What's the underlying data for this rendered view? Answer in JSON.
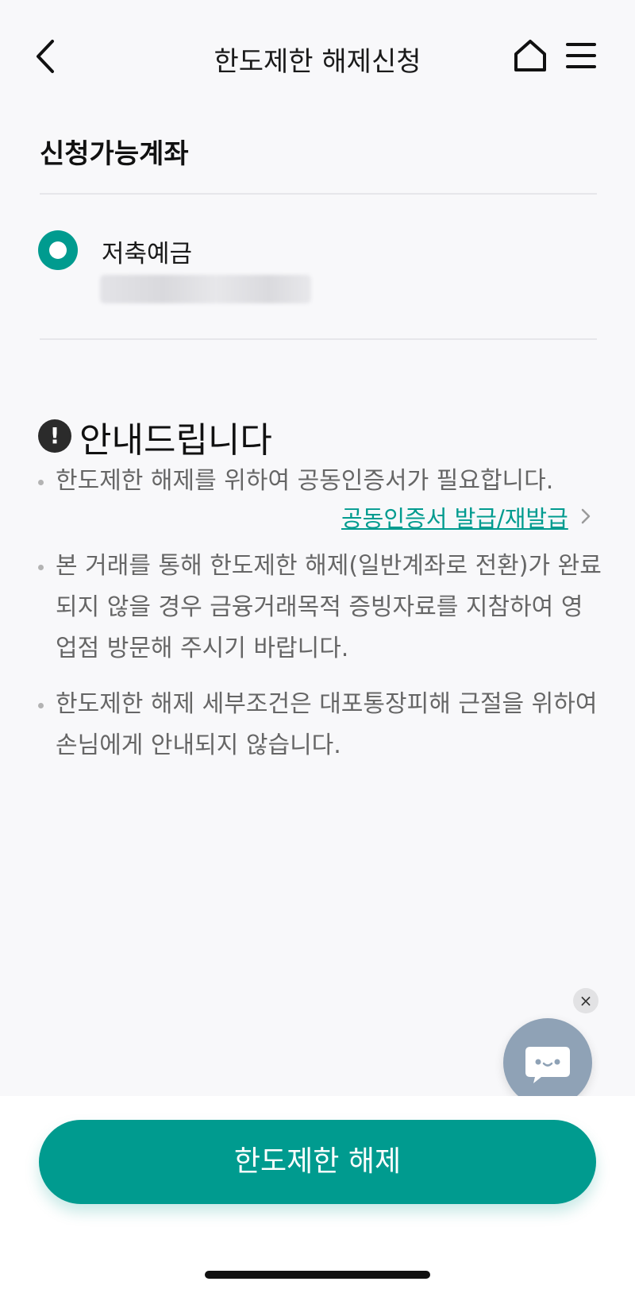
{
  "header": {
    "title": "한도제한 해제신청",
    "back_icon": "chevron-left-icon",
    "home_icon": "home-icon",
    "menu_icon": "hamburger-menu-icon"
  },
  "accounts": {
    "section_title": "신청가능계좌",
    "items": [
      {
        "name": "저축예금",
        "selected": true
      }
    ]
  },
  "notice": {
    "title": "안내드립니다",
    "icon": "exclamation-circle-icon",
    "bullets": [
      "한도제한 해제를 위하여 공동인증서가 필요합니다.",
      "본 거래를 통해 한도제한 해제(일반계좌로 전환)가 완료되지 않을 경우 금융거래목적 증빙자료를 지참하여 영업점 방문해 주시기 바랍니다.",
      "한도제한 해제 세부조건은 대포통장피해 근절을 위하여 손님에게 안내되지 않습니다."
    ],
    "cert_link": "공동인증서 발급/재발급"
  },
  "chatbot": {
    "close_label": "×",
    "icon": "chatbot-icon"
  },
  "cta": {
    "label": "한도제한 해제"
  },
  "colors": {
    "accent": "#009b8f",
    "background": "#f8f8fa",
    "chatbot": "#8fa2b6"
  }
}
